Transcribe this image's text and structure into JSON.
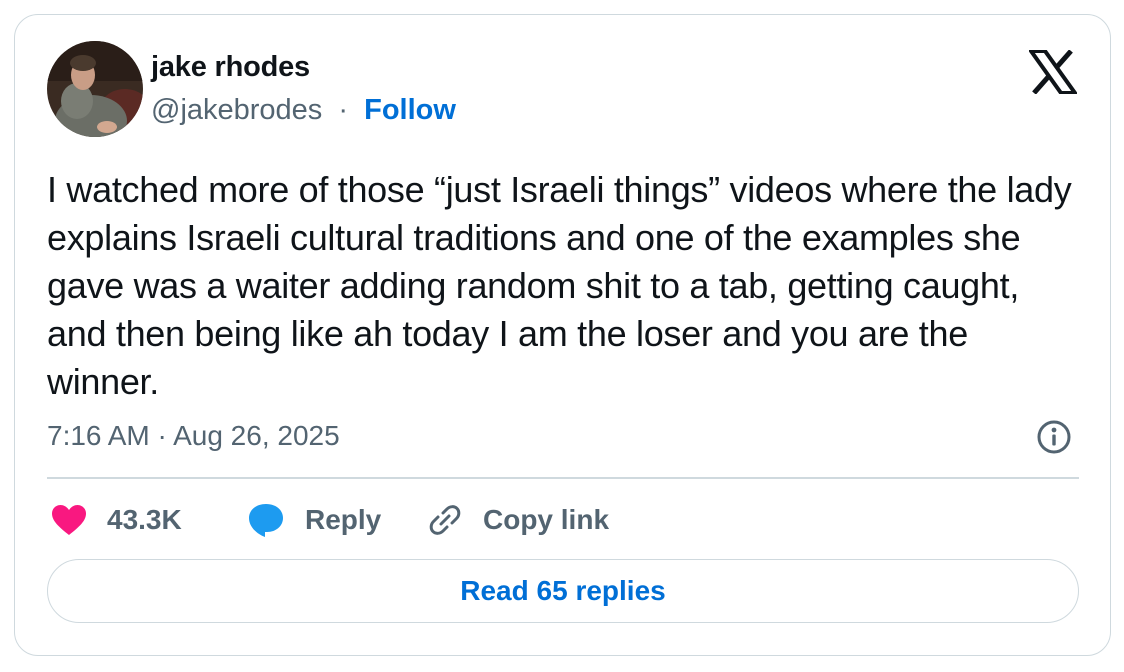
{
  "author": {
    "name": "jake rhodes",
    "handle": "@jakebrodes",
    "separator": "·",
    "follow_label": "Follow"
  },
  "tweet": {
    "text": "I watched more of those “just Israeli things” videos where the lady explains Israeli cultural traditions and one of the examples she gave was a waiter adding random shit to a tab, getting caught, and then being like ah today I am the loser and you are the winner.",
    "timestamp": "7:16 AM · Aug 26, 2025"
  },
  "actions": {
    "like_count": "43.3K",
    "reply_label": "Reply",
    "copy_label": "Copy link"
  },
  "read_replies_label": "Read 65 replies",
  "icons": {
    "logo": "x-logo-icon",
    "info": "info-icon",
    "like": "heart-icon",
    "reply": "speech-bubble-icon",
    "copy": "link-icon"
  },
  "colors": {
    "link": "#006fd6",
    "like": "#f91880",
    "reply": "#1d9bf0",
    "secondary_text": "#536471",
    "border": "#cfd9de"
  }
}
